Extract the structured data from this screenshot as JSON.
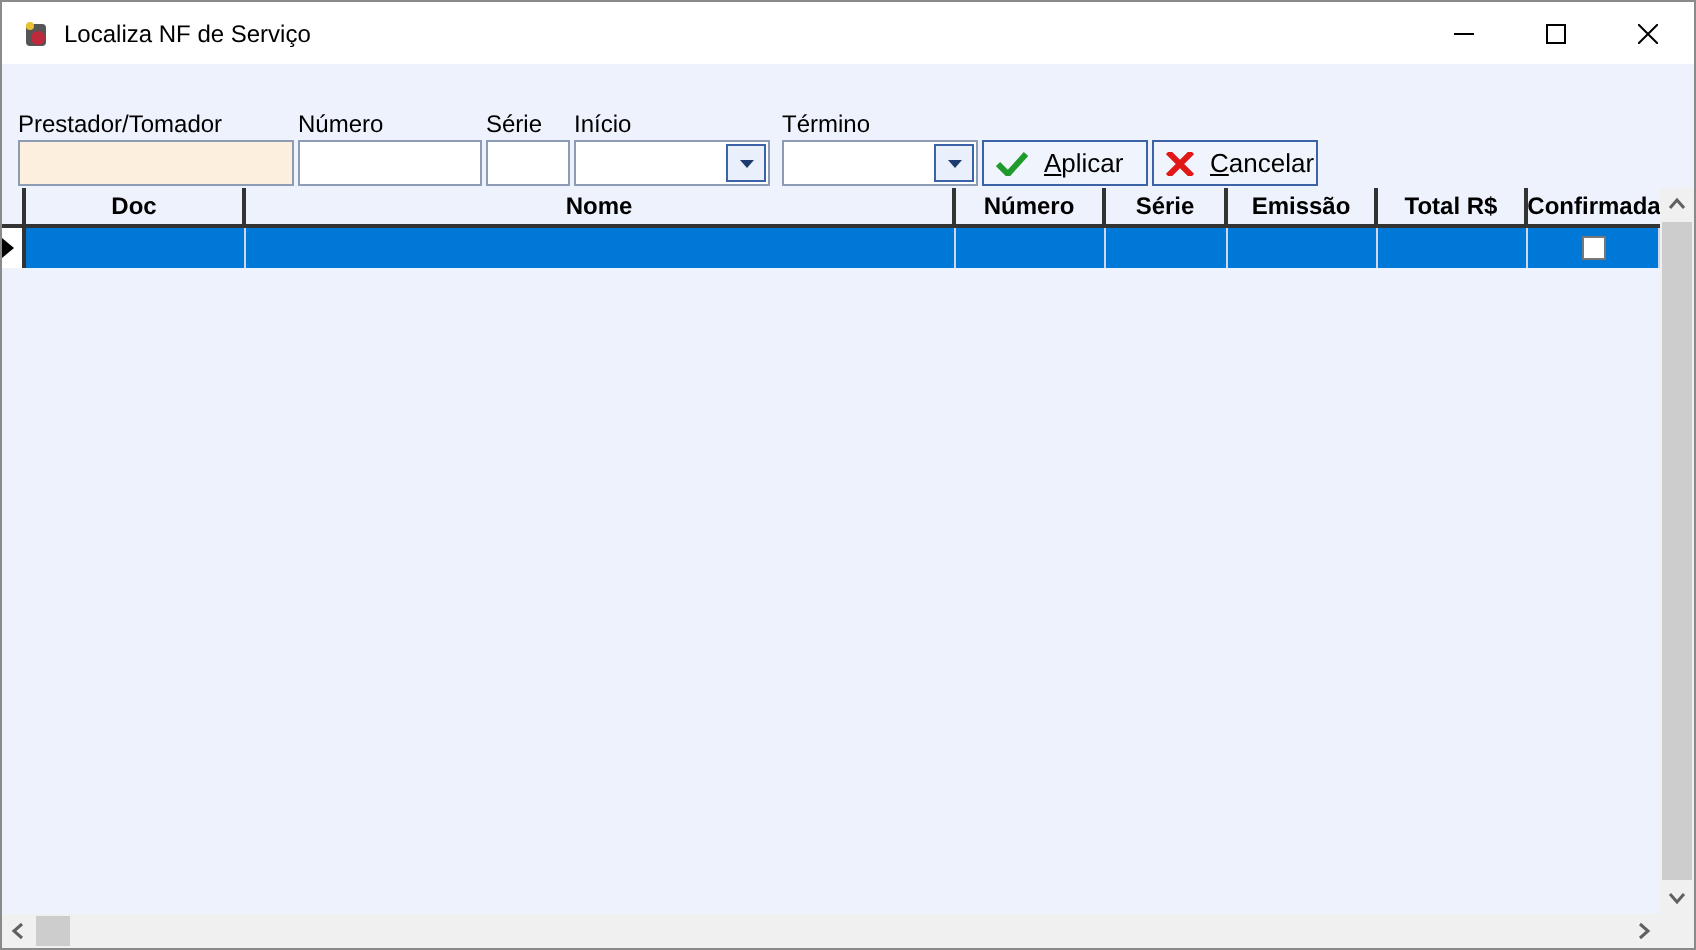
{
  "window": {
    "title": "Localiza NF de Serviço"
  },
  "filters": [
    {
      "label": "Prestador/Tomador",
      "kind": "text",
      "highlighted": true
    },
    {
      "label": "Número",
      "kind": "text",
      "highlighted": false
    },
    {
      "label": "Série",
      "kind": "text",
      "highlighted": false
    },
    {
      "label": "Início",
      "kind": "date",
      "highlighted": false
    },
    {
      "label": "Término",
      "kind": "date",
      "highlighted": false
    }
  ],
  "buttons": [
    {
      "label": "Aplicar",
      "kind": "apply"
    },
    {
      "label": "Cancelar",
      "kind": "cancel"
    }
  ],
  "grid": {
    "columns": [
      "Doc",
      "Nome",
      "Número",
      "Série",
      "Emissão",
      "Total R$",
      "Confirmada"
    ],
    "rows": [
      {
        "selected": true,
        "confirmed": false
      }
    ]
  }
}
